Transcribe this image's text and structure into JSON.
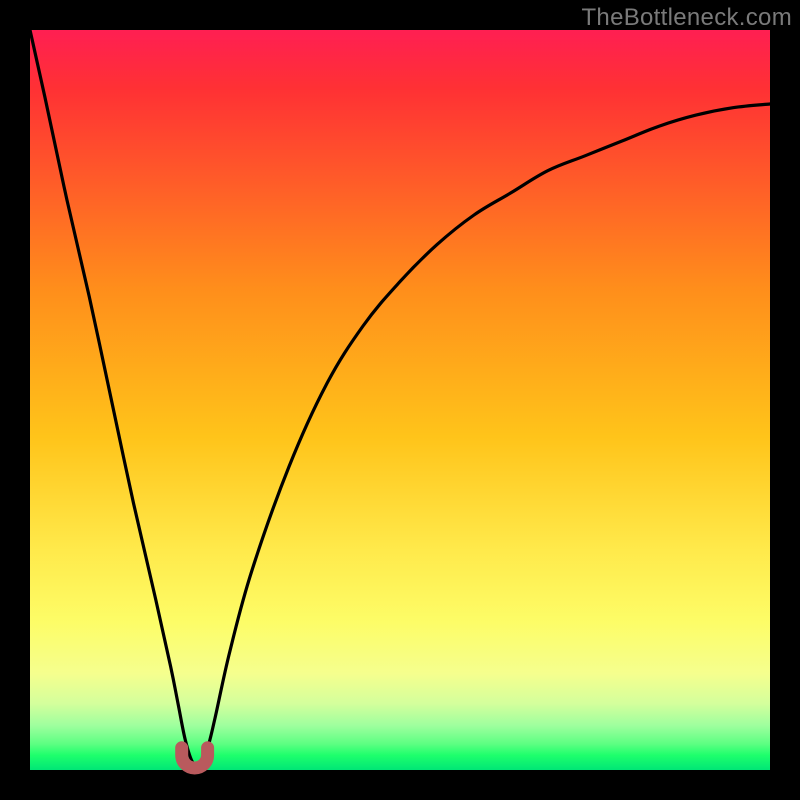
{
  "watermark": "TheBottleneck.com",
  "chart_data": {
    "type": "line",
    "title": "",
    "xlabel": "",
    "ylabel": "",
    "xlim": [
      0,
      100
    ],
    "ylim": [
      0,
      100
    ],
    "grid": false,
    "curve": {
      "description": "V-shaped bottleneck curve: steep descent from top-left to a rounded minimum near x≈22, then a concave rise toward the upper right edge.",
      "x": [
        0,
        2,
        5,
        8,
        11,
        14,
        17,
        19,
        20,
        21,
        22,
        23,
        24,
        25,
        27,
        30,
        35,
        40,
        45,
        50,
        55,
        60,
        65,
        70,
        75,
        80,
        85,
        90,
        95,
        100
      ],
      "y": [
        100,
        91,
        77,
        64,
        50,
        36,
        23,
        14,
        9,
        4,
        1,
        1,
        3,
        7,
        16,
        27,
        41,
        52,
        60,
        66,
        71,
        75,
        78,
        81,
        83,
        85,
        87,
        88.5,
        89.5,
        90
      ]
    },
    "minimum_marker": {
      "x_range": [
        20.5,
        24.0
      ],
      "y_range": [
        0,
        3
      ],
      "color": "#b95a5d",
      "shape": "U"
    },
    "gradient_stops": [
      {
        "pos": 0.0,
        "color": "#ff1f52"
      },
      {
        "pos": 0.08,
        "color": "#ff3134"
      },
      {
        "pos": 0.2,
        "color": "#ff5a29"
      },
      {
        "pos": 0.35,
        "color": "#ff8e1b"
      },
      {
        "pos": 0.55,
        "color": "#ffc41a"
      },
      {
        "pos": 0.7,
        "color": "#ffe94a"
      },
      {
        "pos": 0.8,
        "color": "#fdfd67"
      },
      {
        "pos": 0.87,
        "color": "#f5ff8e"
      },
      {
        "pos": 0.91,
        "color": "#d4ff9c"
      },
      {
        "pos": 0.94,
        "color": "#9eff9e"
      },
      {
        "pos": 0.965,
        "color": "#5cff82"
      },
      {
        "pos": 0.98,
        "color": "#1eff6c"
      },
      {
        "pos": 1.0,
        "color": "#00e676"
      }
    ]
  }
}
